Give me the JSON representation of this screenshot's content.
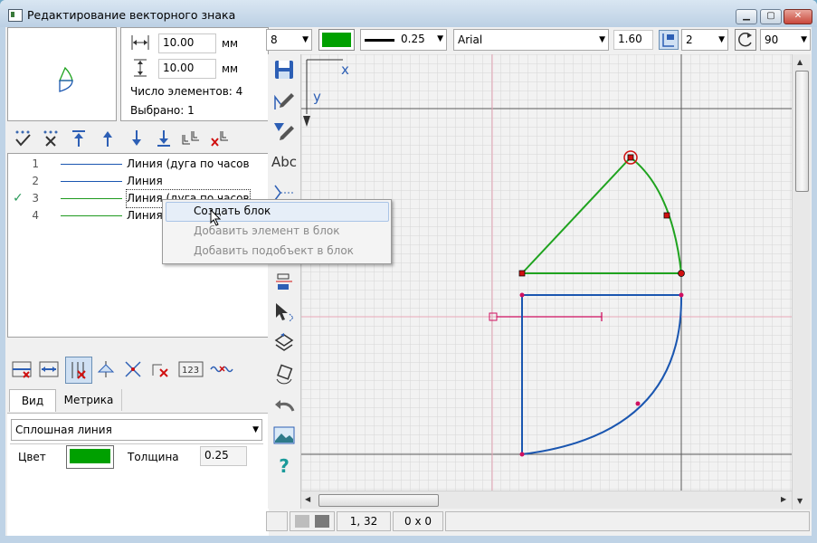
{
  "window": {
    "title": "Редактирование векторного знака"
  },
  "size_panel": {
    "width_value": "10.00",
    "height_value": "10.00",
    "unit_width": "мм",
    "unit_height": "мм",
    "element_count_label": "Число элементов: 4",
    "selected_label": "Выбрано: 1"
  },
  "elements_list": [
    {
      "num": "1",
      "name": "Линия (дуга по часов",
      "color": "#1a56b0",
      "checked": false
    },
    {
      "num": "2",
      "name": "Линия",
      "color": "#1a56b0",
      "checked": false
    },
    {
      "num": "3",
      "name": "Линия (дуга по часов",
      "color": "#1f9a1f",
      "checked": true
    },
    {
      "num": "4",
      "name": "Линия",
      "color": "#1f9a1f",
      "checked": false
    }
  ],
  "context_menu": {
    "items": [
      {
        "label": "Создать блок",
        "enabled": true
      },
      {
        "label": "Добавить элемент в блок",
        "enabled": false
      },
      {
        "label": "Добавить подобъект в блок",
        "enabled": false
      }
    ]
  },
  "tabs": {
    "view": "Вид",
    "metric": "Метрика"
  },
  "properties": {
    "line_type": "Сплошная линия",
    "color_label": "Цвет",
    "color_value": "#00a000",
    "thickness_label": "Толщина",
    "thickness_value": "0.25"
  },
  "top_toolbar": {
    "size_combo": "8",
    "line_width": "0.25",
    "font": "Arial",
    "font_size": "1.60",
    "count_combo": "2",
    "angle_combo": "90",
    "color": "#00a000"
  },
  "canvas": {
    "axis_x_label": "x",
    "axis_y_label": "y",
    "green_color": "#1fa31f",
    "blue_color": "#1a56b0"
  },
  "status_bar": {
    "coords": "1,  32",
    "size": "0 x 0"
  }
}
